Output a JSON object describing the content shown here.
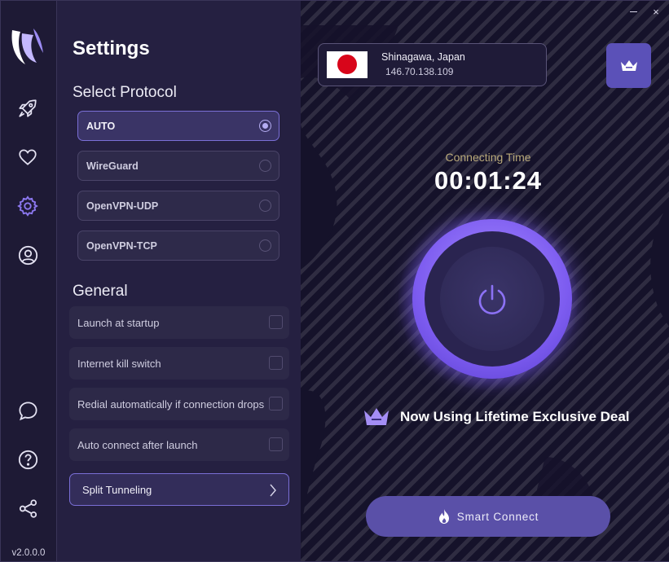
{
  "window": {
    "minimize_label": "",
    "close_label": "×"
  },
  "rail": {
    "items": [
      {
        "name": "rocket-icon"
      },
      {
        "name": "heart-icon"
      },
      {
        "name": "gear-icon",
        "active": true
      },
      {
        "name": "user-icon"
      },
      {
        "name": "chat-icon"
      },
      {
        "name": "help-icon"
      },
      {
        "name": "share-icon"
      }
    ],
    "version": "v2.0.0.0"
  },
  "settings": {
    "title": "Settings",
    "protocol_heading": "Select Protocol",
    "protocols": [
      {
        "label": "AUTO",
        "selected": true
      },
      {
        "label": "WireGuard",
        "selected": false
      },
      {
        "label": "OpenVPN-UDP",
        "selected": false
      },
      {
        "label": "OpenVPN-TCP",
        "selected": false
      }
    ],
    "general_heading": "General",
    "options": [
      {
        "label": "Launch at startup",
        "checked": false
      },
      {
        "label": "Internet kill switch",
        "checked": false
      },
      {
        "label": "Redial automatically if connection drops",
        "checked": false
      },
      {
        "label": "Auto connect after launch",
        "checked": false
      }
    ],
    "split_tunneling": "Split Tunneling"
  },
  "main": {
    "server": {
      "location": "Shinagawa, Japan",
      "ip": "146.70.138.109",
      "flag": "japan-flag"
    },
    "connecting_label": "Connecting Time",
    "connecting_time": "00:01:24",
    "deal_text": "Now Using Lifetime Exclusive Deal",
    "smart_connect": "Smart Connect"
  },
  "colors": {
    "accent": "#7d5cf0",
    "panel": "#252041",
    "rail": "#1e1a35",
    "map": "#15122a"
  }
}
